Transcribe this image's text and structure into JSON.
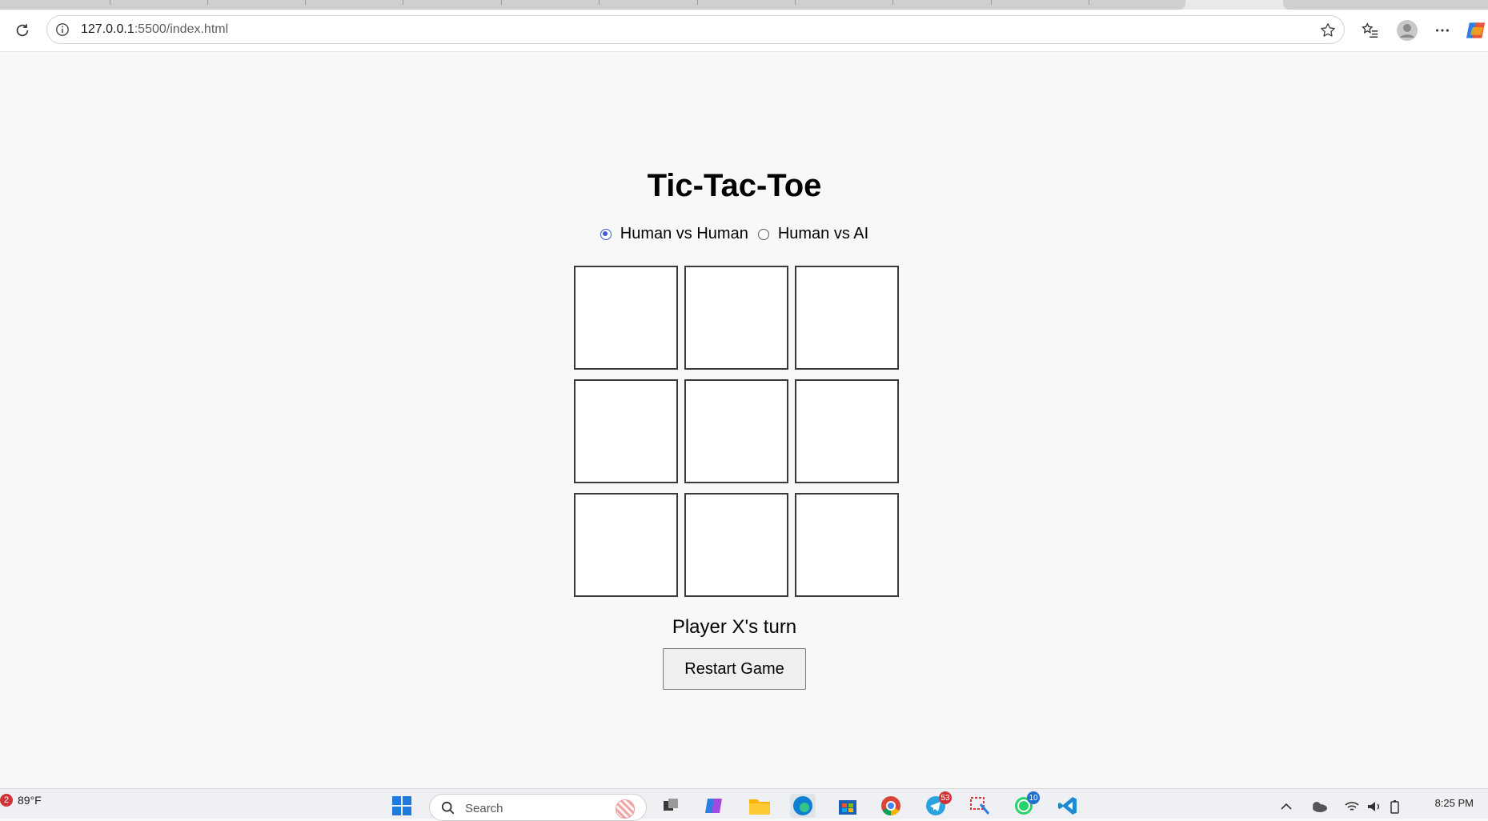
{
  "browser": {
    "url_host": "127.0.0.1",
    "url_rest": ":5500/index.html"
  },
  "page": {
    "title": "Tic-Tac-Toe",
    "modes": [
      {
        "label": "Human vs Human",
        "checked": true
      },
      {
        "label": "Human vs AI",
        "checked": false
      }
    ],
    "board": [
      "",
      "",
      "",
      "",
      "",
      "",
      "",
      "",
      ""
    ],
    "status": "Player X's turn",
    "restart_label": "Restart Game"
  },
  "taskbar": {
    "weather_badge": "2",
    "temperature": "89°F",
    "search_placeholder": "Search",
    "telegram_badge": "53",
    "whatsapp_badge": "10",
    "time": "8:25 PM"
  },
  "colors": {
    "radio_accent": "#3b5bd6",
    "page_background": "#f8f8f8"
  }
}
